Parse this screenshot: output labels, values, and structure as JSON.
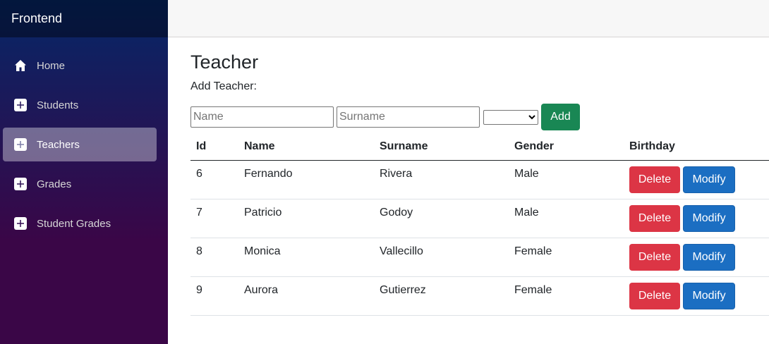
{
  "brand": "Frontend",
  "sidebar": {
    "items": [
      {
        "label": "Home",
        "icon": "home-icon",
        "active": false
      },
      {
        "label": "Students",
        "icon": "plus-icon",
        "active": false
      },
      {
        "label": "Teachers",
        "icon": "plus-icon",
        "active": true
      },
      {
        "label": "Grades",
        "icon": "plus-icon",
        "active": false
      },
      {
        "label": "Student Grades",
        "icon": "plus-icon",
        "active": false
      }
    ]
  },
  "page": {
    "title": "Teacher",
    "add_label": "Add Teacher:"
  },
  "form": {
    "name_placeholder": "Name",
    "surname_placeholder": "Surname",
    "gender_value": "",
    "add_button": "Add"
  },
  "table": {
    "headers": {
      "id": "Id",
      "name": "Name",
      "surname": "Surname",
      "gender": "Gender",
      "birthday": "Birthday"
    },
    "rows": [
      {
        "id": "6",
        "name": "Fernando",
        "surname": "Rivera",
        "gender": "Male"
      },
      {
        "id": "7",
        "name": "Patricio",
        "surname": "Godoy",
        "gender": "Male"
      },
      {
        "id": "8",
        "name": "Monica",
        "surname": "Vallecillo",
        "gender": "Female"
      },
      {
        "id": "9",
        "name": "Aurora",
        "surname": "Gutierrez",
        "gender": "Female"
      }
    ],
    "delete_label": "Delete",
    "modify_label": "Modify"
  },
  "colors": {
    "sidebar_top": "#052767",
    "sidebar_bottom": "#3a0647",
    "add_button": "#198754",
    "delete_button": "#dc3545",
    "modify_button": "#1b6ec2"
  }
}
